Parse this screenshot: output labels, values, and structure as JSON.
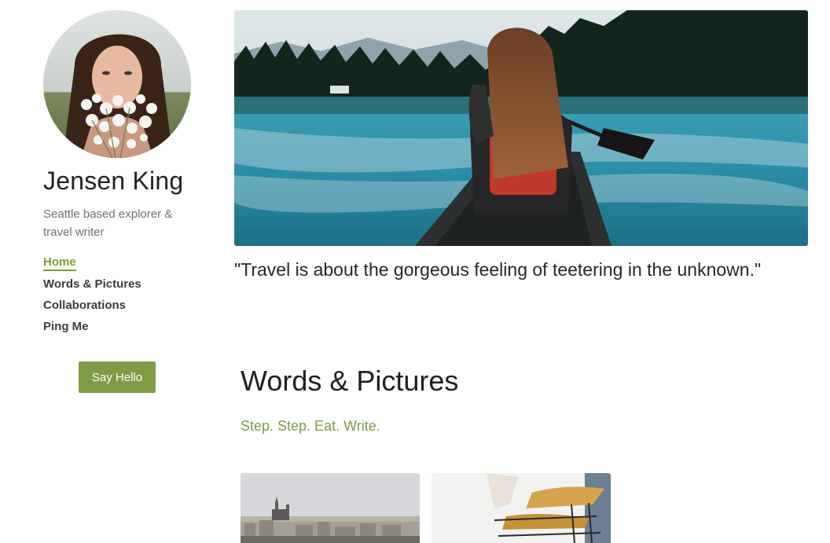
{
  "profile": {
    "name": "Jensen King",
    "bio": "Seattle based explorer & travel writer",
    "avatar_icon": "portrait-with-flowers"
  },
  "nav": {
    "items": [
      {
        "label": "Home",
        "active": true
      },
      {
        "label": "Words & Pictures",
        "active": false
      },
      {
        "label": "Collaborations",
        "active": false
      },
      {
        "label": "Ping Me",
        "active": false
      }
    ]
  },
  "cta": {
    "label": "Say Hello"
  },
  "hero": {
    "image_icon": "woman-canoeing-on-lake-photo",
    "quote": "\"Travel is about the gorgeous feeling of teetering in the unknown.\""
  },
  "section": {
    "title": "Words & Pictures",
    "subtitle": "Step. Step. Eat. Write.",
    "thumbnails": [
      {
        "icon": "paris-cityscape-photo"
      },
      {
        "icon": "food-dehydrator-photo"
      }
    ]
  },
  "colors": {
    "accent": "#7f9c45",
    "text": "#2b2b2b",
    "muted": "#707070",
    "background": "#ffffff"
  }
}
